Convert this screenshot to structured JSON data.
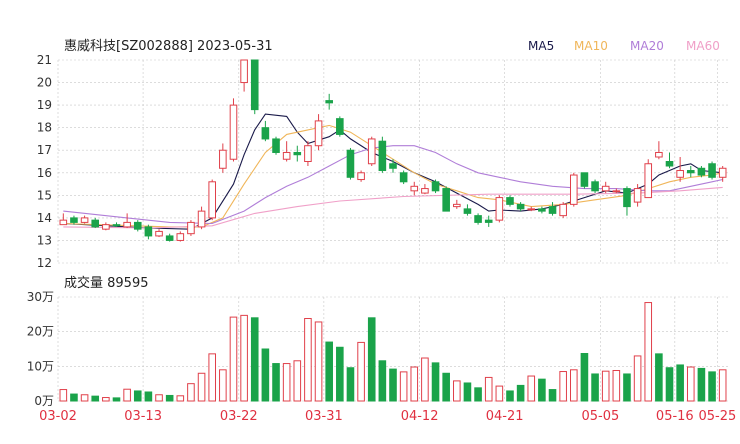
{
  "header": {
    "title": "惠威科技[SZ002888] 2023-05-31",
    "ma_legend": [
      {
        "label": "MA5",
        "color": "#1a1a4a"
      },
      {
        "label": "MA10",
        "color": "#f0b65a"
      },
      {
        "label": "MA20",
        "color": "#b07ed8"
      },
      {
        "label": "MA60",
        "color": "#f0a0c8"
      }
    ]
  },
  "volume_label": "成交量 89595",
  "colors": {
    "up": "#e0404a",
    "down": "#1aa34a",
    "grid": "#c8c8c8"
  },
  "chart_data": [
    {
      "type": "candlestick",
      "ylim": [
        12,
        21
      ],
      "yticks": [
        "12",
        "13",
        "14",
        "15",
        "16",
        "17",
        "18",
        "19",
        "20",
        "21"
      ],
      "xticks": [
        "03-02",
        "03-13",
        "03-22",
        "03-31",
        "04-12",
        "04-21",
        "05-05",
        "05-16",
        "05-25"
      ],
      "ohlc": [
        [
          13.7,
          13.9,
          13.85,
          14.2
        ],
        [
          14.0,
          13.8,
          13.7,
          14.1
        ],
        [
          13.8,
          14.0,
          13.75,
          14.1
        ],
        [
          13.9,
          13.6,
          13.55,
          14.0
        ],
        [
          13.5,
          13.7,
          13.45,
          13.8
        ],
        [
          13.7,
          13.65,
          13.6,
          13.8
        ],
        [
          13.6,
          13.8,
          13.55,
          14.2
        ],
        [
          13.8,
          13.5,
          13.4,
          13.9
        ],
        [
          13.6,
          13.2,
          13.05,
          13.7
        ],
        [
          13.2,
          13.4,
          13.15,
          13.5
        ],
        [
          13.2,
          13.0,
          12.95,
          13.3
        ],
        [
          13.0,
          13.3,
          12.95,
          13.4
        ],
        [
          13.3,
          13.8,
          13.2,
          13.9
        ],
        [
          13.6,
          14.3,
          13.5,
          14.5
        ],
        [
          14.0,
          15.6,
          13.9,
          15.7
        ],
        [
          16.2,
          17.0,
          16.0,
          17.3
        ],
        [
          16.6,
          19.0,
          16.5,
          19.3
        ],
        [
          20.0,
          21.0,
          19.6,
          21.0
        ],
        [
          21.0,
          18.8,
          18.6,
          21.0
        ],
        [
          18.0,
          17.5,
          17.4,
          18.3
        ],
        [
          17.5,
          16.9,
          16.8,
          17.6
        ],
        [
          16.6,
          16.9,
          16.5,
          17.4
        ],
        [
          16.9,
          16.8,
          16.5,
          17.2
        ],
        [
          16.5,
          17.2,
          16.3,
          17.4
        ],
        [
          17.2,
          18.3,
          17.0,
          18.6
        ],
        [
          19.2,
          19.1,
          18.8,
          19.5
        ],
        [
          18.4,
          17.7,
          17.6,
          18.5
        ],
        [
          17.0,
          15.8,
          15.7,
          17.1
        ],
        [
          15.7,
          16.0,
          15.6,
          16.1
        ],
        [
          16.4,
          17.5,
          16.3,
          17.6
        ],
        [
          17.4,
          16.1,
          16.0,
          17.6
        ],
        [
          16.4,
          16.2,
          16.0,
          16.6
        ],
        [
          16.0,
          15.6,
          15.5,
          16.1
        ],
        [
          15.2,
          15.4,
          15.0,
          15.6
        ],
        [
          15.1,
          15.3,
          15.05,
          15.5
        ],
        [
          15.6,
          15.2,
          15.1,
          15.7
        ],
        [
          15.3,
          14.3,
          14.3,
          15.4
        ],
        [
          14.5,
          14.6,
          14.4,
          14.8
        ],
        [
          14.4,
          14.2,
          14.1,
          14.6
        ],
        [
          14.1,
          13.8,
          13.7,
          14.2
        ],
        [
          13.9,
          13.8,
          13.6,
          14.1
        ],
        [
          13.9,
          14.9,
          13.8,
          15.0
        ],
        [
          14.9,
          14.6,
          14.5,
          15.0
        ],
        [
          14.6,
          14.4,
          14.3,
          14.7
        ],
        [
          14.4,
          14.4,
          14.3,
          14.5
        ],
        [
          14.4,
          14.3,
          14.2,
          14.5
        ],
        [
          14.5,
          14.2,
          14.1,
          14.7
        ],
        [
          14.1,
          14.6,
          14.0,
          14.7
        ],
        [
          14.6,
          15.9,
          14.5,
          16.0
        ],
        [
          16.0,
          15.4,
          15.3,
          16.0
        ],
        [
          15.6,
          15.2,
          15.1,
          15.7
        ],
        [
          15.2,
          15.4,
          15.1,
          15.6
        ],
        [
          15.2,
          15.2,
          15.1,
          15.3
        ],
        [
          15.3,
          14.5,
          14.1,
          15.4
        ],
        [
          14.7,
          15.3,
          14.5,
          15.5
        ],
        [
          14.9,
          16.4,
          14.9,
          16.6
        ],
        [
          16.7,
          16.9,
          16.6,
          17.4
        ],
        [
          16.5,
          16.3,
          16.2,
          16.9
        ],
        [
          15.8,
          16.1,
          15.6,
          16.7
        ],
        [
          16.1,
          16.0,
          15.8,
          16.3
        ],
        [
          16.2,
          15.9,
          15.8,
          16.3
        ],
        [
          16.4,
          15.8,
          15.7,
          16.5
        ],
        [
          15.8,
          16.2,
          15.6,
          16.3
        ]
      ],
      "ma": [
        {
          "name": "MA5",
          "color": "#1a1a4a",
          "points": [
            [
              0,
              13.75
            ],
            [
              8,
              13.55
            ],
            [
              12,
              13.5
            ],
            [
              14,
              14.0
            ],
            [
              16,
              15.5
            ],
            [
              17,
              16.8
            ],
            [
              18,
              17.9
            ],
            [
              19,
              18.6
            ],
            [
              21,
              18.5
            ],
            [
              22,
              17.8
            ],
            [
              23,
              17.3
            ],
            [
              25,
              17.6
            ],
            [
              26,
              17.9
            ],
            [
              27,
              17.5
            ],
            [
              29,
              16.9
            ],
            [
              31,
              16.5
            ],
            [
              33,
              16.0
            ],
            [
              35,
              15.6
            ],
            [
              37,
              15.1
            ],
            [
              39,
              14.6
            ],
            [
              40,
              14.3
            ],
            [
              41,
              14.35
            ],
            [
              43,
              14.3
            ],
            [
              45,
              14.4
            ],
            [
              47,
              14.6
            ],
            [
              49,
              14.9
            ],
            [
              51,
              15.2
            ],
            [
              53,
              15.1
            ],
            [
              55,
              15.5
            ],
            [
              56,
              15.9
            ],
            [
              57,
              16.1
            ],
            [
              58,
              16.3
            ],
            [
              59,
              16.4
            ],
            [
              60,
              16.1
            ],
            [
              62,
              16.0
            ]
          ]
        },
        {
          "name": "MA10",
          "color": "#f0b65a",
          "points": [
            [
              0,
              13.75
            ],
            [
              10,
              13.6
            ],
            [
              13,
              13.6
            ],
            [
              15,
              14.0
            ],
            [
              17,
              15.5
            ],
            [
              19,
              16.9
            ],
            [
              21,
              17.7
            ],
            [
              23,
              17.9
            ],
            [
              25,
              18.1
            ],
            [
              27,
              17.8
            ],
            [
              29,
              17.2
            ],
            [
              31,
              16.6
            ],
            [
              33,
              16.0
            ],
            [
              35,
              15.5
            ],
            [
              37,
              15.2
            ],
            [
              39,
              14.9
            ],
            [
              41,
              14.8
            ],
            [
              44,
              14.5
            ],
            [
              47,
              14.6
            ],
            [
              50,
              14.8
            ],
            [
              53,
              15.0
            ],
            [
              55,
              15.3
            ],
            [
              57,
              15.6
            ],
            [
              59,
              15.8
            ],
            [
              61,
              15.9
            ],
            [
              62,
              16.0
            ]
          ]
        },
        {
          "name": "MA20",
          "color": "#b07ed8",
          "points": [
            [
              0,
              14.3
            ],
            [
              6,
              14.0
            ],
            [
              10,
              13.8
            ],
            [
              14,
              13.75
            ],
            [
              17,
              14.3
            ],
            [
              19,
              14.9
            ],
            [
              21,
              15.4
            ],
            [
              23,
              15.8
            ],
            [
              25,
              16.3
            ],
            [
              27,
              16.8
            ],
            [
              29,
              17.1
            ],
            [
              31,
              17.2
            ],
            [
              33,
              17.2
            ],
            [
              35,
              16.9
            ],
            [
              37,
              16.4
            ],
            [
              39,
              16.0
            ],
            [
              41,
              15.8
            ],
            [
              43,
              15.6
            ],
            [
              46,
              15.4
            ],
            [
              49,
              15.3
            ],
            [
              52,
              15.3
            ],
            [
              55,
              15.2
            ],
            [
              57,
              15.2
            ],
            [
              59,
              15.4
            ],
            [
              61,
              15.6
            ],
            [
              62,
              15.7
            ]
          ]
        },
        {
          "name": "MA60",
          "color": "#f0a0c8",
          "points": [
            [
              0,
              13.6
            ],
            [
              8,
              13.55
            ],
            [
              14,
              13.65
            ],
            [
              18,
              14.2
            ],
            [
              22,
              14.5
            ],
            [
              26,
              14.75
            ],
            [
              32,
              14.95
            ],
            [
              40,
              15.05
            ],
            [
              48,
              15.05
            ],
            [
              54,
              15.1
            ],
            [
              58,
              15.2
            ],
            [
              62,
              15.35
            ]
          ]
        }
      ]
    },
    {
      "type": "bar",
      "ylim": [
        0,
        30
      ],
      "yticks": [
        "0万",
        "10万",
        "20万",
        "30万"
      ],
      "values": [
        3.3,
        2.0,
        1.8,
        1.4,
        1.0,
        0.9,
        3.4,
        2.9,
        2.6,
        1.8,
        1.6,
        1.5,
        5.0,
        8.0,
        13.6,
        9.0,
        24.2,
        24.7,
        24.0,
        15.0,
        10.8,
        10.8,
        11.6,
        23.8,
        22.8,
        17.0,
        15.5,
        9.6,
        16.9,
        24.0,
        11.6,
        9.2,
        8.4,
        9.8,
        12.4,
        11.0,
        8.0,
        5.8,
        5.2,
        3.8,
        6.8,
        4.3,
        2.9,
        4.5,
        7.2,
        6.3,
        3.3,
        8.5,
        9.0,
        13.7,
        7.8,
        8.6,
        8.8,
        7.8,
        13.0,
        28.4,
        13.6,
        9.6,
        10.4,
        9.8,
        9.4,
        8.4,
        9.0
      ],
      "colors": [
        "up",
        "down",
        "up",
        "down",
        "up",
        "down",
        "up",
        "down",
        "down",
        "up",
        "down",
        "up",
        "up",
        "up",
        "up",
        "up",
        "up",
        "up",
        "down",
        "down",
        "down",
        "up",
        "up",
        "up",
        "up",
        "down",
        "down",
        "down",
        "up",
        "down",
        "down",
        "down",
        "up",
        "up",
        "up",
        "down",
        "down",
        "up",
        "down",
        "down",
        "up",
        "up",
        "down",
        "down",
        "up",
        "down",
        "down",
        "up",
        "up",
        "down",
        "down",
        "up",
        "up",
        "down",
        "up",
        "up",
        "down",
        "down",
        "down",
        "up",
        "down",
        "down",
        "up"
      ]
    }
  ]
}
